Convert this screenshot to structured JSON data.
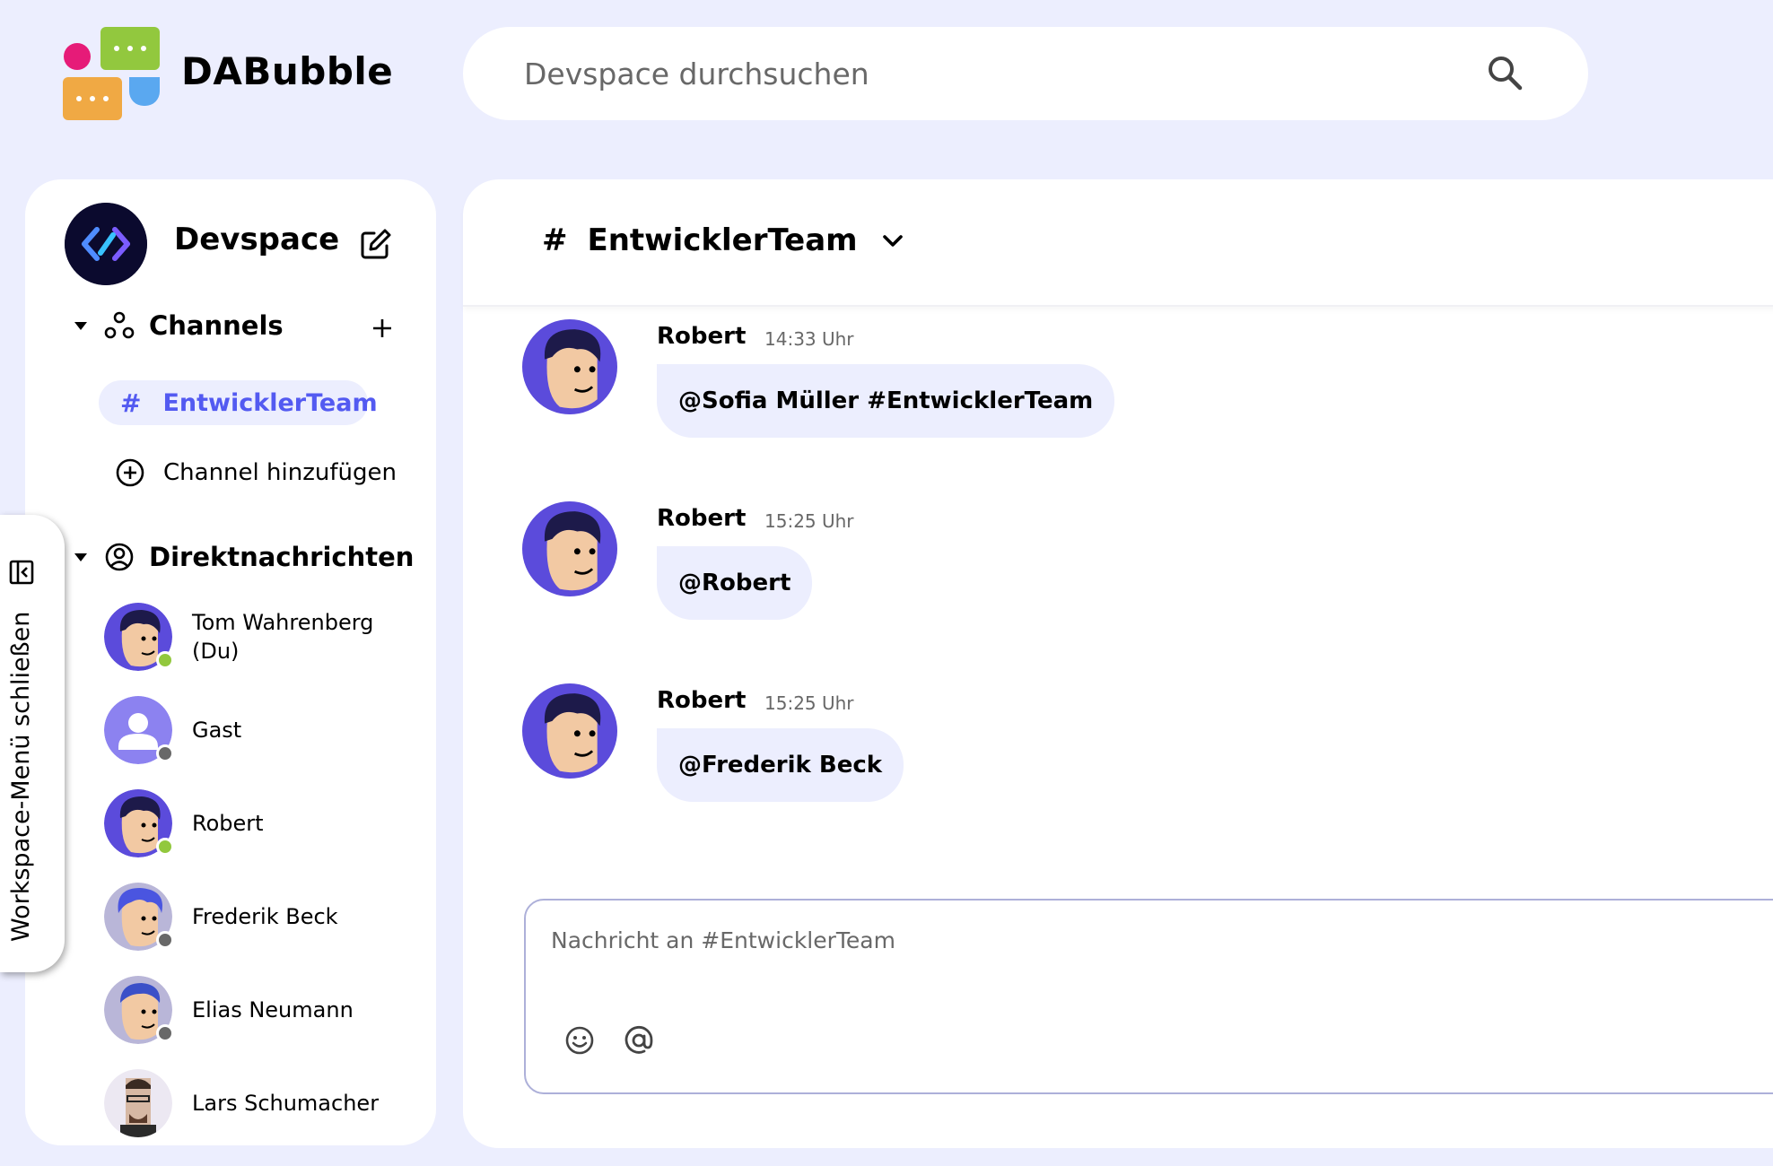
{
  "app": {
    "brand": "DABubble"
  },
  "search": {
    "placeholder": "Devspace durchsuchen"
  },
  "workspace": {
    "title": "Devspace",
    "channels_label": "Channels",
    "active_channel": "EntwicklerTeam",
    "add_channel_label": "Channel hinzufügen",
    "direct_messages_label": "Direktnachrichten",
    "users": [
      {
        "name": "Tom Wahrenberg (Du)",
        "status": "online"
      },
      {
        "name": "Gast",
        "status": "offline"
      },
      {
        "name": "Robert",
        "status": "online"
      },
      {
        "name": "Frederik Beck",
        "status": "offline"
      },
      {
        "name": "Elias Neumann",
        "status": "offline"
      },
      {
        "name": "Lars Schumacher",
        "status": "offline"
      }
    ],
    "toggle_label": "Workspace-Menü schließen"
  },
  "chat": {
    "hash": "#",
    "channel_name": "EntwicklerTeam",
    "messages": [
      {
        "author": "Robert",
        "time": "14:33 Uhr",
        "text": "@Sofia Müller #EntwicklerTeam"
      },
      {
        "author": "Robert",
        "time": "15:25 Uhr",
        "text": "@Robert"
      },
      {
        "author": "Robert",
        "time": "15:25 Uhr",
        "text": "@Frederik Beck"
      }
    ],
    "composer_placeholder": "Nachricht an #EntwicklerTeam"
  },
  "colors": {
    "background": "#eceefe",
    "accent": "#535af1",
    "online": "#92c83e",
    "offline": "#686868"
  }
}
